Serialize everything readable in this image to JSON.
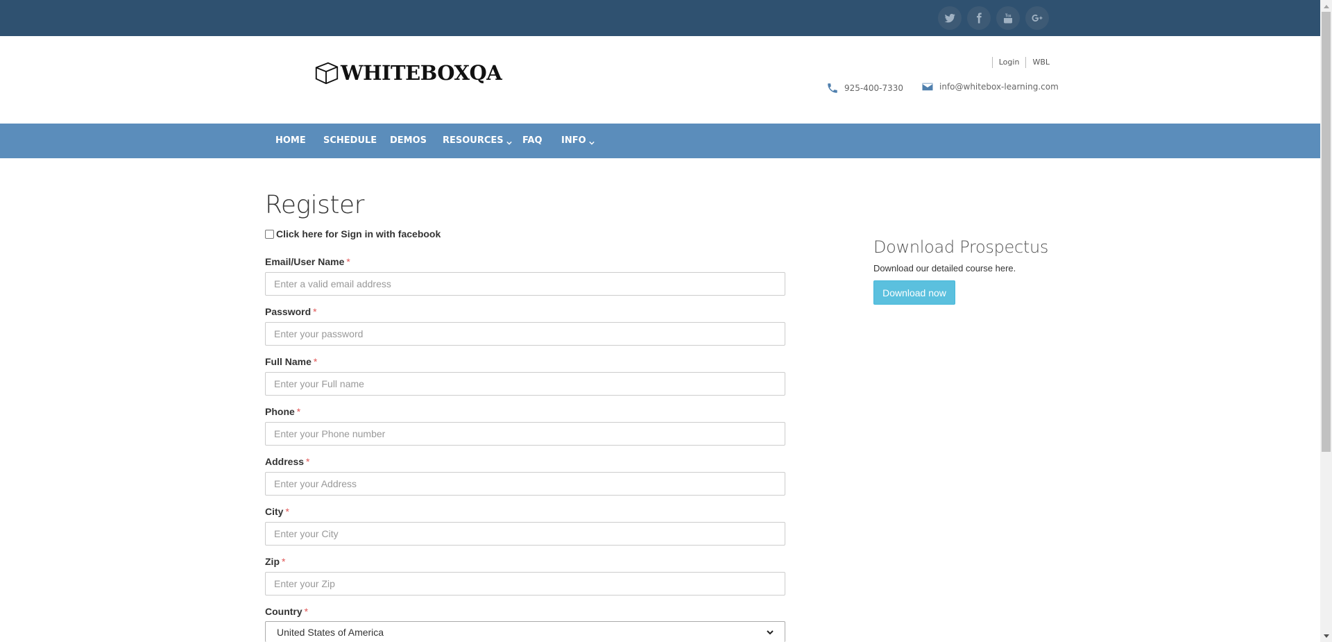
{
  "social": [
    {
      "name": "twitter-icon"
    },
    {
      "name": "facebook-icon"
    },
    {
      "name": "youtube-icon"
    },
    {
      "name": "google-plus-icon"
    }
  ],
  "header": {
    "logo_text": "WHITEBOXQA",
    "login_link": "Login",
    "wbl_link": "WBL",
    "phone": "925-400-7330",
    "email": "info@whitebox-learning.com"
  },
  "nav": {
    "home": "HOME",
    "schedule": "SCHEDULE",
    "demos": "DEMOS",
    "resources": "RESOURCES",
    "faq": "FAQ",
    "info": "INFO"
  },
  "form": {
    "title": "Register",
    "facebook_checkbox_label": "Click here for Sign in with facebook",
    "required_mark": "*",
    "email_label": "Email/User Name",
    "email_placeholder": "Enter a valid email address",
    "password_label": "Password",
    "password_placeholder": "Enter your password",
    "fullname_label": "Full Name",
    "fullname_placeholder": "Enter your Full name",
    "phone_label": "Phone",
    "phone_placeholder": "Enter your Phone number",
    "address_label": "Address",
    "address_placeholder": "Enter your Address",
    "city_label": "City",
    "city_placeholder": "Enter your City",
    "zip_label": "Zip",
    "zip_placeholder": "Enter your Zip",
    "country_label": "Country",
    "country_value": "United States of America"
  },
  "sidebar": {
    "title": "Download Prospectus",
    "text": "Download our detailed course here.",
    "button": "Download now"
  },
  "colors": {
    "topbar": "#2f5170",
    "navbar": "#5b8dbb",
    "button": "#5bc0de",
    "required": "#e05555"
  }
}
